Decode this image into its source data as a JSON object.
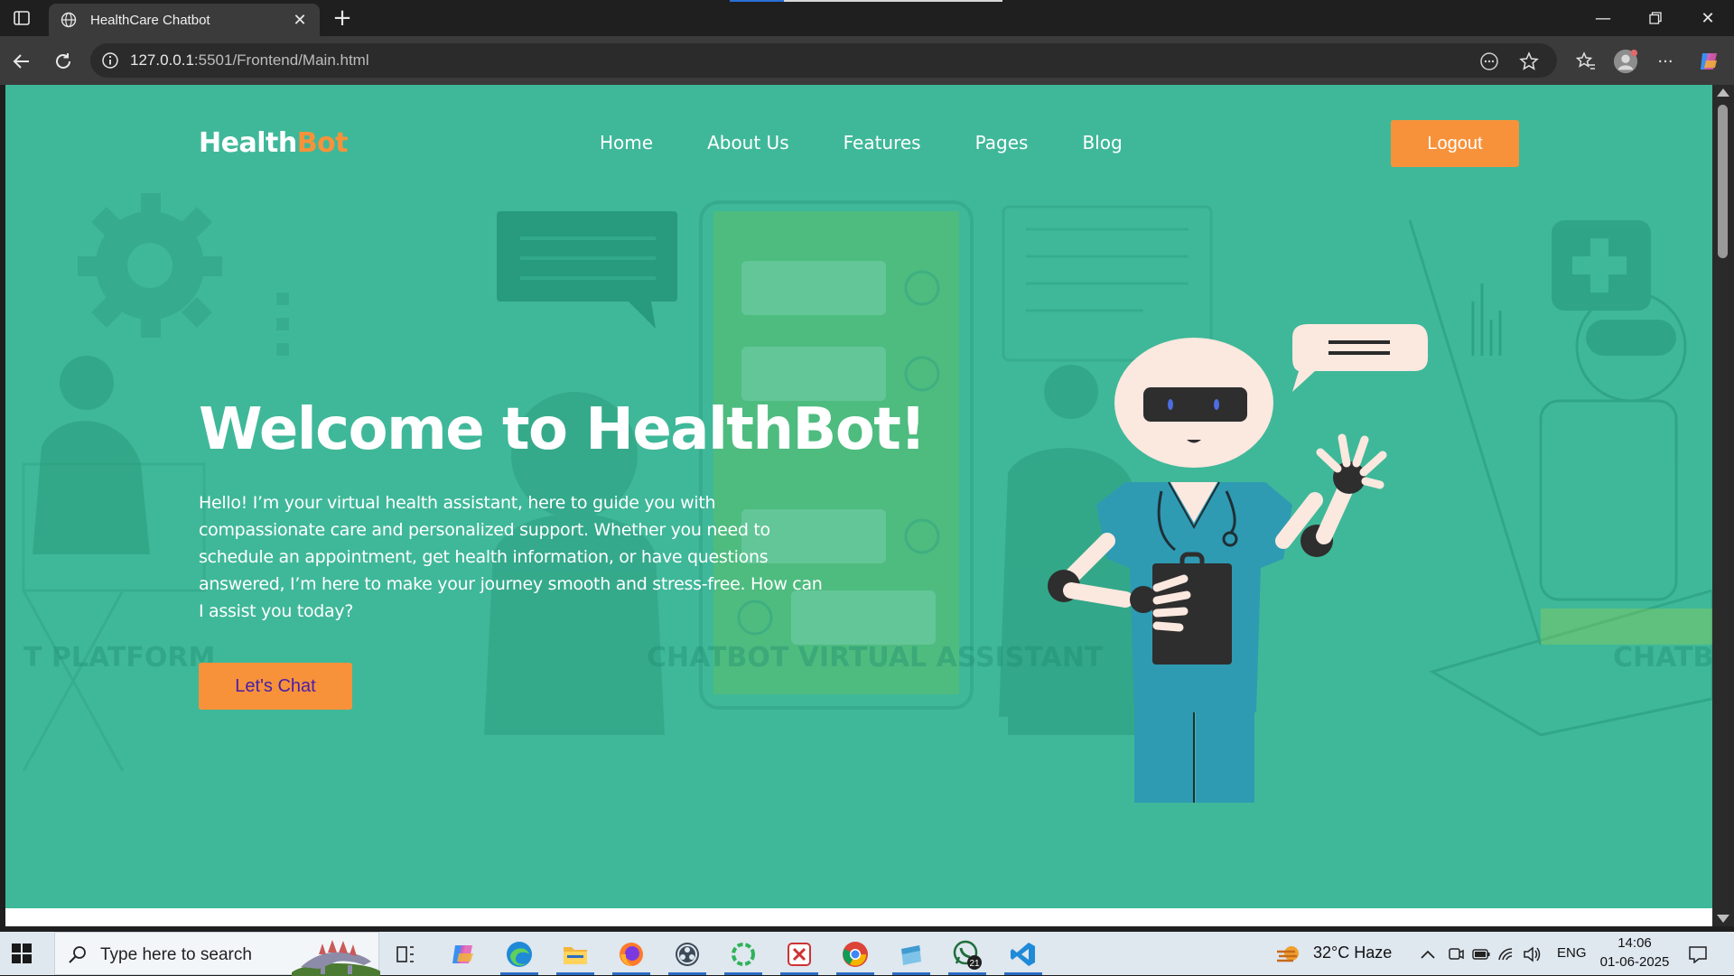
{
  "browser": {
    "tab_title": "HealthCare Chatbot",
    "url_host": "127.0.0.1",
    "url_rest": ":5501/Frontend/Main.html"
  },
  "site": {
    "logo_main": "Health",
    "logo_accent": "Bot",
    "nav": [
      "Home",
      "About Us",
      "Features",
      "Pages",
      "Blog"
    ],
    "logout_label": "Logout",
    "hero_title": "Welcome to HealthBot!",
    "hero_text_lines": [
      "Hello! I’m your virtual health assistant, here to guide you with",
      "compassionate care and personalized support. Whether you need to",
      "schedule an appointment, get health information, or have questions",
      "answered, I’m here to make your journey smooth and stress-free. How can",
      "I assist you today?"
    ],
    "cta_label": "Let's Chat",
    "bg_captions": [
      "T PLATFORM",
      "CHATBOT VIRTUAL ASSISTANT",
      "CHATB"
    ]
  },
  "taskbar": {
    "search_placeholder": "Type here to search",
    "weather": "32°C  Haze",
    "language": "ENG",
    "time": "14:06",
    "date": "01-06-2025",
    "whatsapp_badge": "21"
  },
  "colors": {
    "hero_bg": "#3fb899",
    "accent": "#f7923a",
    "cta_text": "#4a1ea8"
  }
}
